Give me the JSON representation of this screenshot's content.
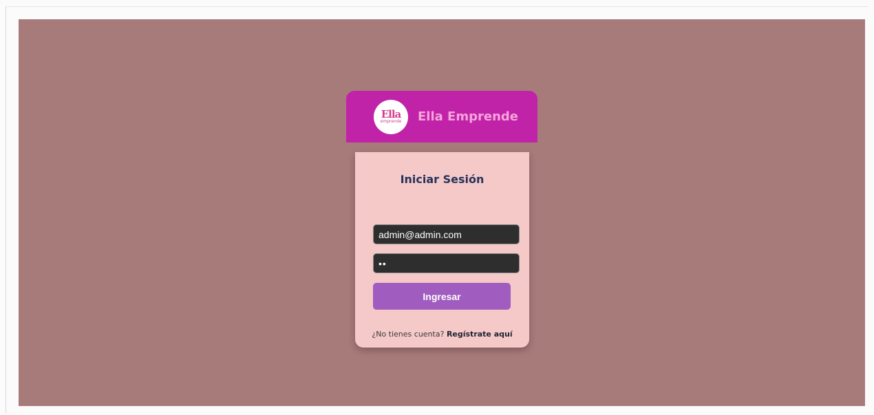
{
  "brand": {
    "name": "Ella Emprende",
    "logo_text": "Ella",
    "logo_subtext": "emprende"
  },
  "login": {
    "title": "Iniciar Sesión",
    "email_value": "admin@admin.com",
    "password_value": "••",
    "submit_label": "Ingresar",
    "register_prompt": "¿No tienes cuenta?",
    "register_link": "Regístrate aquí"
  },
  "colors": {
    "page_background": "#a87b7b",
    "header": "#c023a8",
    "card": "#f4c9c8",
    "button": "#a05dbf",
    "brand_text": "#f6a5dc"
  }
}
